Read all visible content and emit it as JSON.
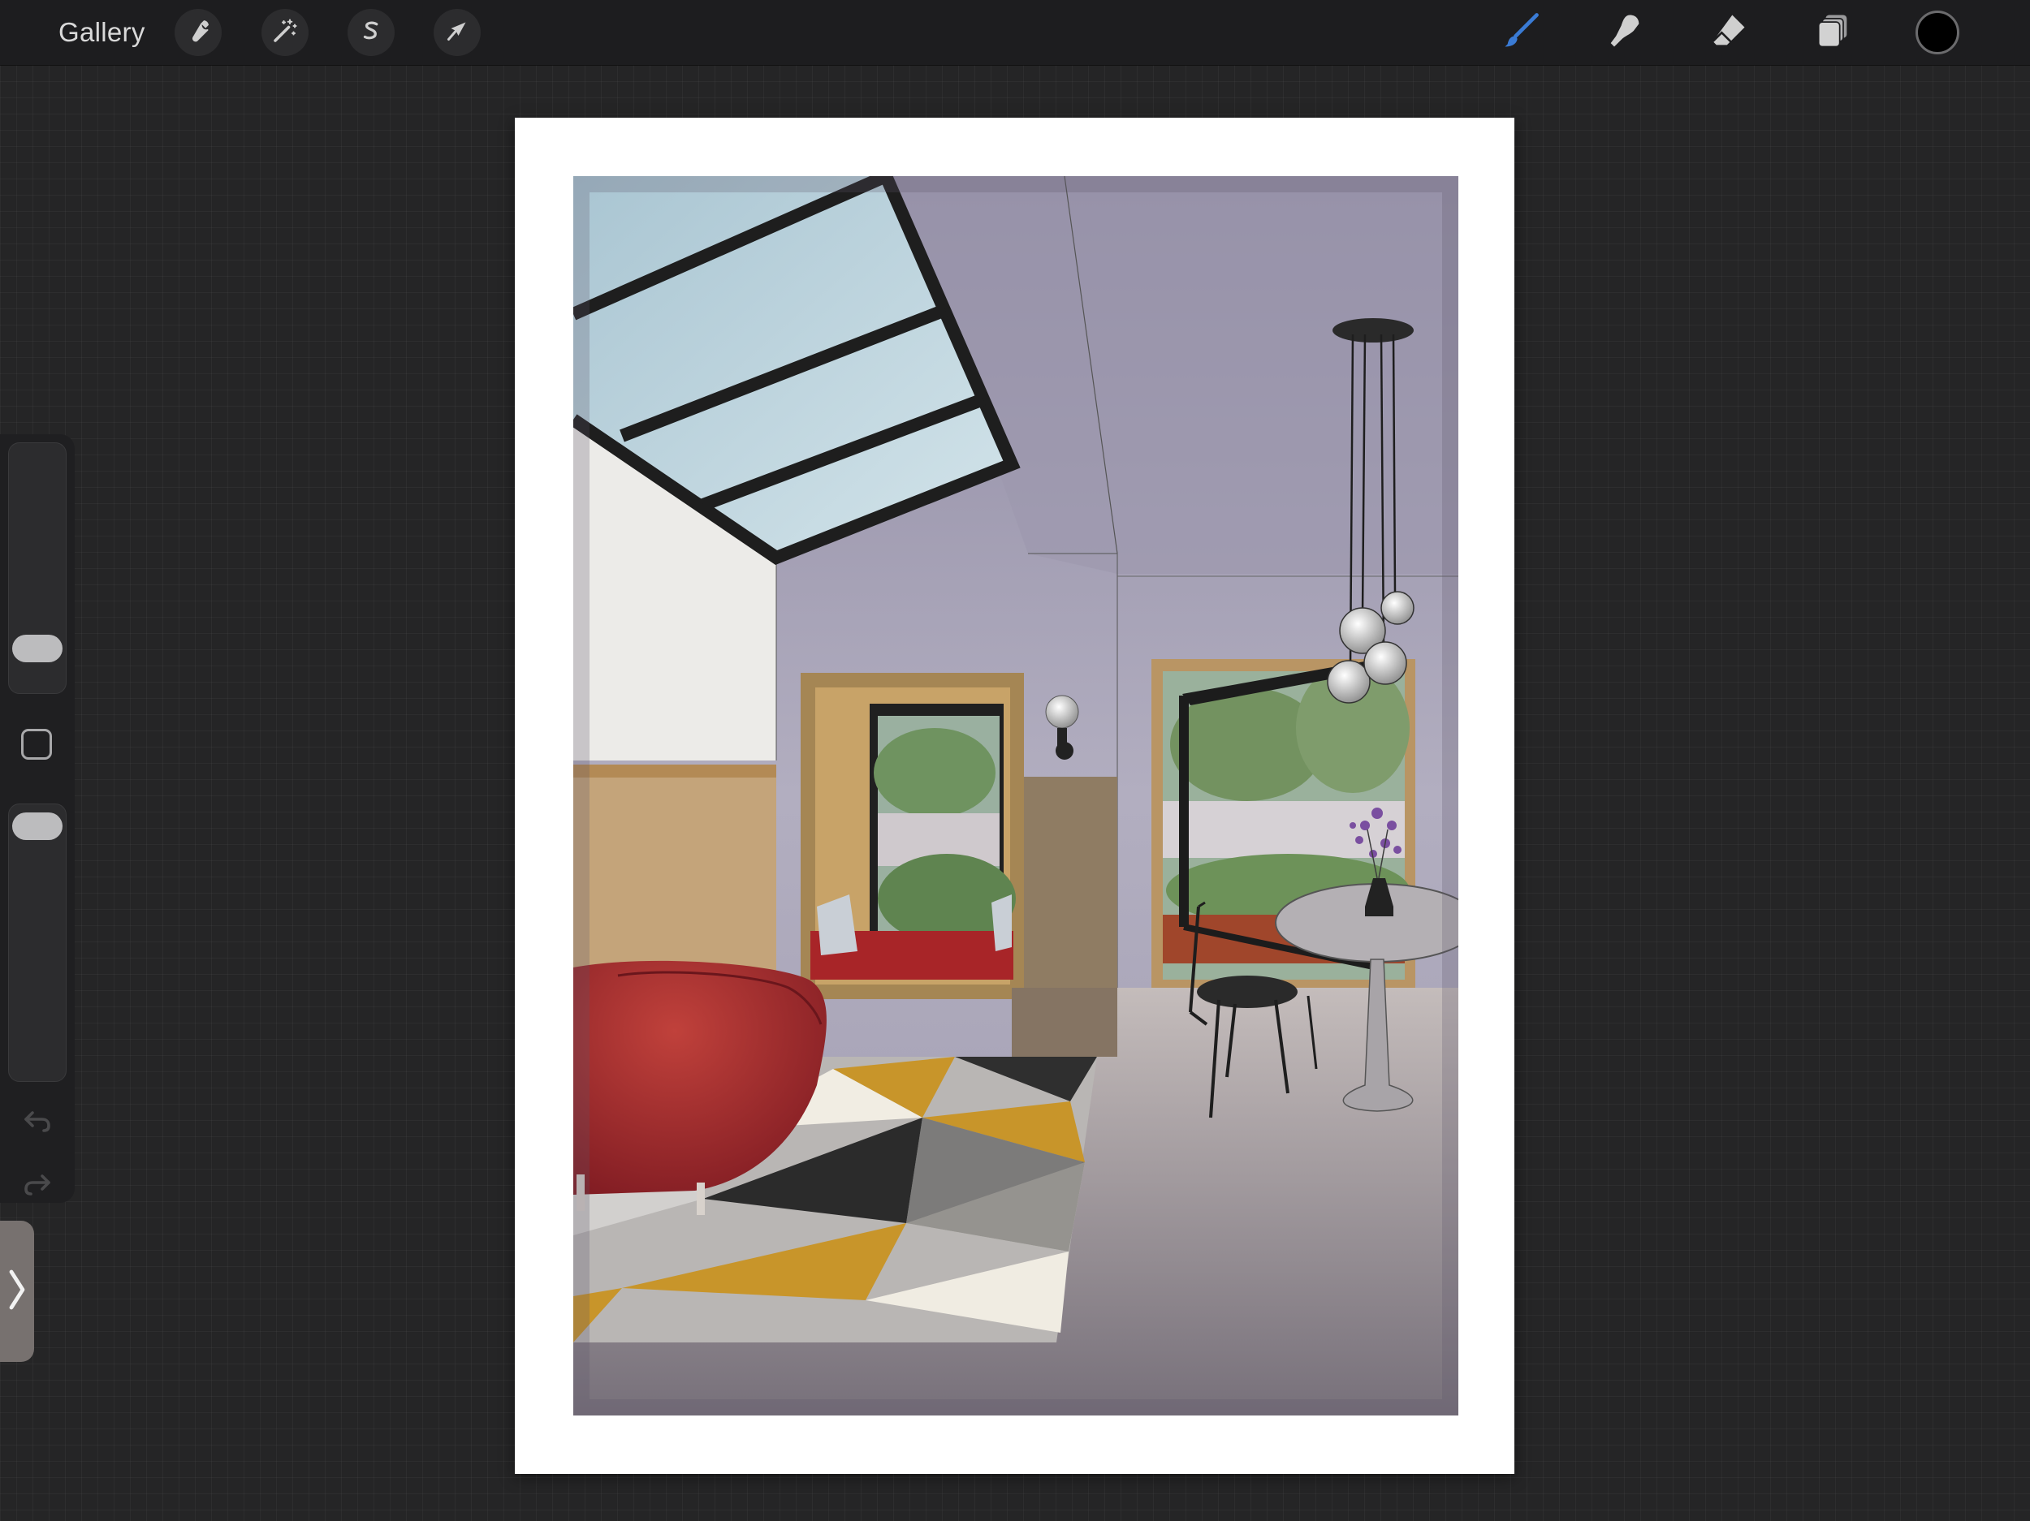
{
  "toolbar": {
    "gallery_label": "Gallery",
    "left_tools": [
      {
        "name": "actions",
        "icon": "wrench-icon"
      },
      {
        "name": "adjustments",
        "icon": "magic-wand-icon"
      },
      {
        "name": "selection",
        "icon": "selection-s-icon"
      },
      {
        "name": "transform",
        "icon": "arrow-cursor-icon"
      }
    ],
    "right_tools": [
      {
        "name": "brush",
        "icon": "brush-icon",
        "active": true,
        "active_color": "#3a7bd5"
      },
      {
        "name": "smudge",
        "icon": "smudge-finger-icon"
      },
      {
        "name": "eraser",
        "icon": "eraser-icon"
      },
      {
        "name": "layers",
        "icon": "layers-icon"
      }
    ],
    "current_color": "#000000"
  },
  "sidebar": {
    "brush_size_level": 0.2,
    "opacity_level": 1.0,
    "modifier_icon": "square-modifier-icon",
    "undo_icon": "undo-icon",
    "redo_icon": "redo-icon",
    "expand_icon": "chevron-right-icon"
  },
  "canvas": {
    "paper_color": "#ffffff",
    "artwork": "watercolor-interior-illustration",
    "palette": {
      "sky": "#b9d3dd",
      "wall": "#a8a4b8",
      "wood": "#b79a6a",
      "sofa": "#a8262a",
      "rug_mustard": "#c8952a",
      "floor": "#a9a3a6"
    }
  }
}
